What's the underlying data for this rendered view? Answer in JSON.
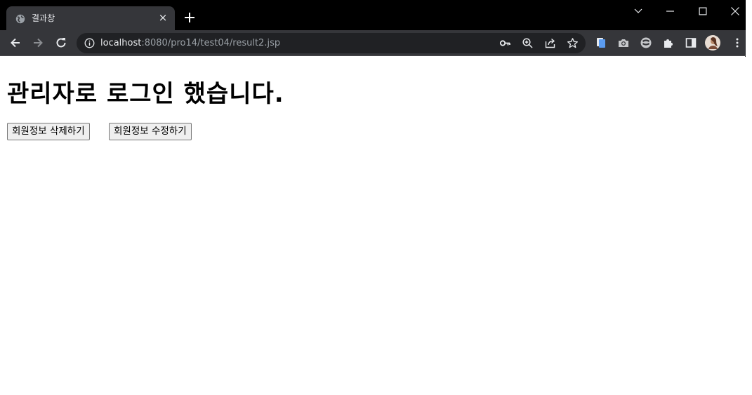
{
  "browser": {
    "tab": {
      "title": "결과창",
      "favicon": "globe-icon",
      "close": "×"
    },
    "address": {
      "host": "localhost",
      "path": ":8080/pro14/test04/result2.jsp"
    },
    "window_controls": [
      "chevron-down-icon",
      "minimize-icon",
      "maximize-icon",
      "close-icon"
    ],
    "omnibox_icons": [
      "key-icon",
      "zoom-icon",
      "share-icon",
      "star-icon"
    ],
    "extension_icons": [
      "extension-doc-icon",
      "camera-icon",
      "extension-circle-icon",
      "puzzle-icon",
      "side-panel-icon",
      "avatar"
    ]
  },
  "page": {
    "heading": "관리자로 로그인 했습니다.",
    "buttons": {
      "delete_label": "회원정보 삭제하기",
      "edit_label": "회원정보 수정하기"
    }
  },
  "colors": {
    "titlebar": "#000000",
    "toolbar": "#35363a",
    "omnibox": "#202124",
    "page": "#ffffff"
  }
}
